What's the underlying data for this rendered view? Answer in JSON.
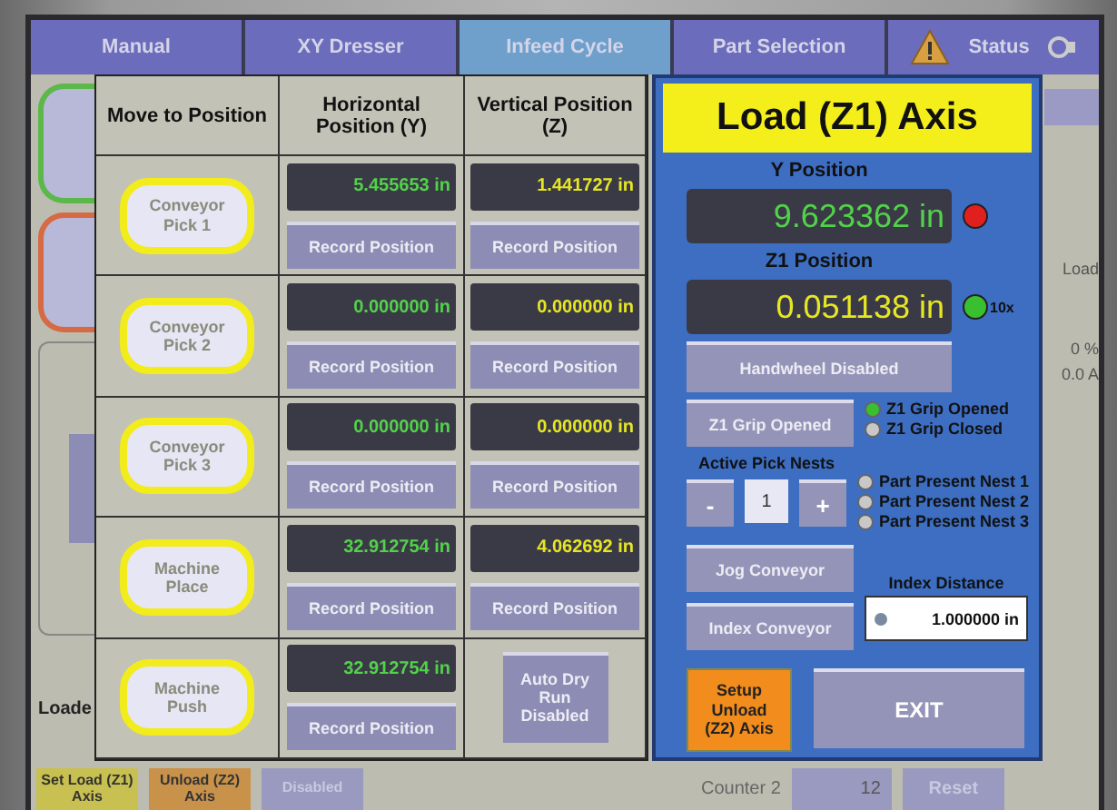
{
  "tabs": [
    {
      "label": "Manual",
      "selected": false,
      "kind": "plain"
    },
    {
      "label": "XY Dresser",
      "selected": false,
      "kind": "plain"
    },
    {
      "label": "Infeed Cycle",
      "selected": true,
      "kind": "plain"
    },
    {
      "label": "Part Selection",
      "selected": false,
      "kind": "plain"
    },
    {
      "label": "Status",
      "selected": false,
      "kind": "status"
    }
  ],
  "background": {
    "loader_label": "Loade",
    "gauge": {
      "label": "Load",
      "percent": "0 %",
      "amps": "0.0 A"
    },
    "bottom_buttons": [
      {
        "label": "Set Load (Z1) Axis",
        "kind": "load"
      },
      {
        "label": "Unload (Z2) Axis",
        "kind": "unload"
      },
      {
        "label": "Disabled",
        "kind": "disabled"
      }
    ],
    "counter": {
      "label": "Counter 2",
      "value": "12",
      "reset": "Reset"
    }
  },
  "table": {
    "columns": [
      "Move to Position",
      "Horizontal Position (Y)",
      "Vertical Position (Z)"
    ],
    "rows": [
      {
        "position": "Conveyor Pick 1",
        "y": "5.455653 in",
        "y_button": "Record Position",
        "z": "1.441727 in",
        "z_button": "Record Position"
      },
      {
        "position": "Conveyor Pick 2",
        "y": "0.000000 in",
        "y_button": "Record Position",
        "z": "0.000000 in",
        "z_button": "Record Position"
      },
      {
        "position": "Conveyor Pick 3",
        "y": "0.000000 in",
        "y_button": "Record Position",
        "z": "0.000000 in",
        "z_button": "Record Position"
      },
      {
        "position": "Machine Place",
        "y": "32.912754 in",
        "y_button": "Record Position",
        "z": "4.062692 in",
        "z_button": "Record Position"
      },
      {
        "position": "Machine Push",
        "y": "32.912754 in",
        "y_button": "Record Position",
        "action": "Auto Dry Run Disabled"
      }
    ]
  },
  "axis_panel": {
    "title": "Load (Z1) Axis",
    "positions": [
      {
        "label": "Y Position",
        "value": "9.623362 in",
        "kind": "y",
        "color": "#e0201e"
      },
      {
        "label": "Z1 Position",
        "value": "0.051138 in",
        "kind": "z",
        "color": "#38c030",
        "note": "10x"
      }
    ],
    "handwheel_button": "Handwheel Disabled",
    "grip_button": "Z1 Grip Opened",
    "grip_states": [
      {
        "label": "Z1 Grip Opened",
        "on": true
      },
      {
        "label": "Z1 Grip Closed",
        "on": false
      }
    ],
    "pick_nests": {
      "label": "Active Pick Nests",
      "minus": "-",
      "value": "1",
      "plus": "+"
    },
    "nest_states": [
      {
        "label": "Part Present Nest 1",
        "on": false
      },
      {
        "label": "Part Present Nest 2",
        "on": false
      },
      {
        "label": "Part Present Nest 3",
        "on": false
      }
    ],
    "jog_button": "Jog Conveyor",
    "index_button": "Index Conveyor",
    "index_distance": {
      "label": "Index Distance",
      "value": "1.000000 in"
    },
    "setup_button": "Setup Unload (Z2) Axis",
    "exit_button": "EXIT"
  }
}
